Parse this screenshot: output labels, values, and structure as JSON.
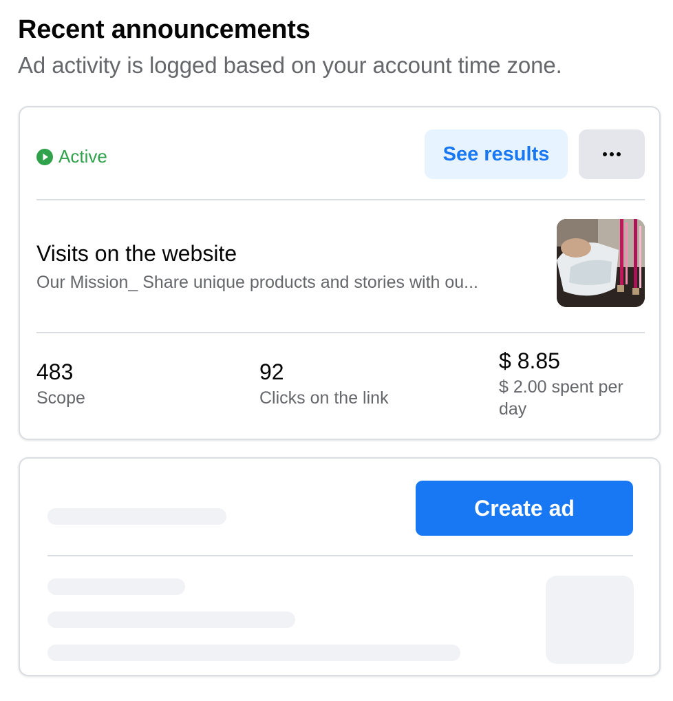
{
  "section": {
    "title": "Recent announcements",
    "subtitle": "Ad activity is logged based on your account time zone."
  },
  "ad_card": {
    "status": "Active",
    "see_results_label": "See results",
    "more_label": "···",
    "ad_title": "Visits on the website",
    "ad_description": "Our Mission_ Share unique products and stories with ou...",
    "metrics": [
      {
        "value": "483",
        "label": "Scope"
      },
      {
        "value": "92",
        "label": "Clicks on the link"
      },
      {
        "value": "$ 8.85",
        "label": "$ 2.00 spent per day"
      }
    ]
  },
  "placeholder_card": {
    "create_ad_label": "Create ad"
  },
  "colors": {
    "accent": "#1877f2",
    "accent_light": "#e7f3ff",
    "active_green": "#31a24c",
    "secondary_text": "#65676b",
    "skeleton": "#f0f2f5"
  }
}
